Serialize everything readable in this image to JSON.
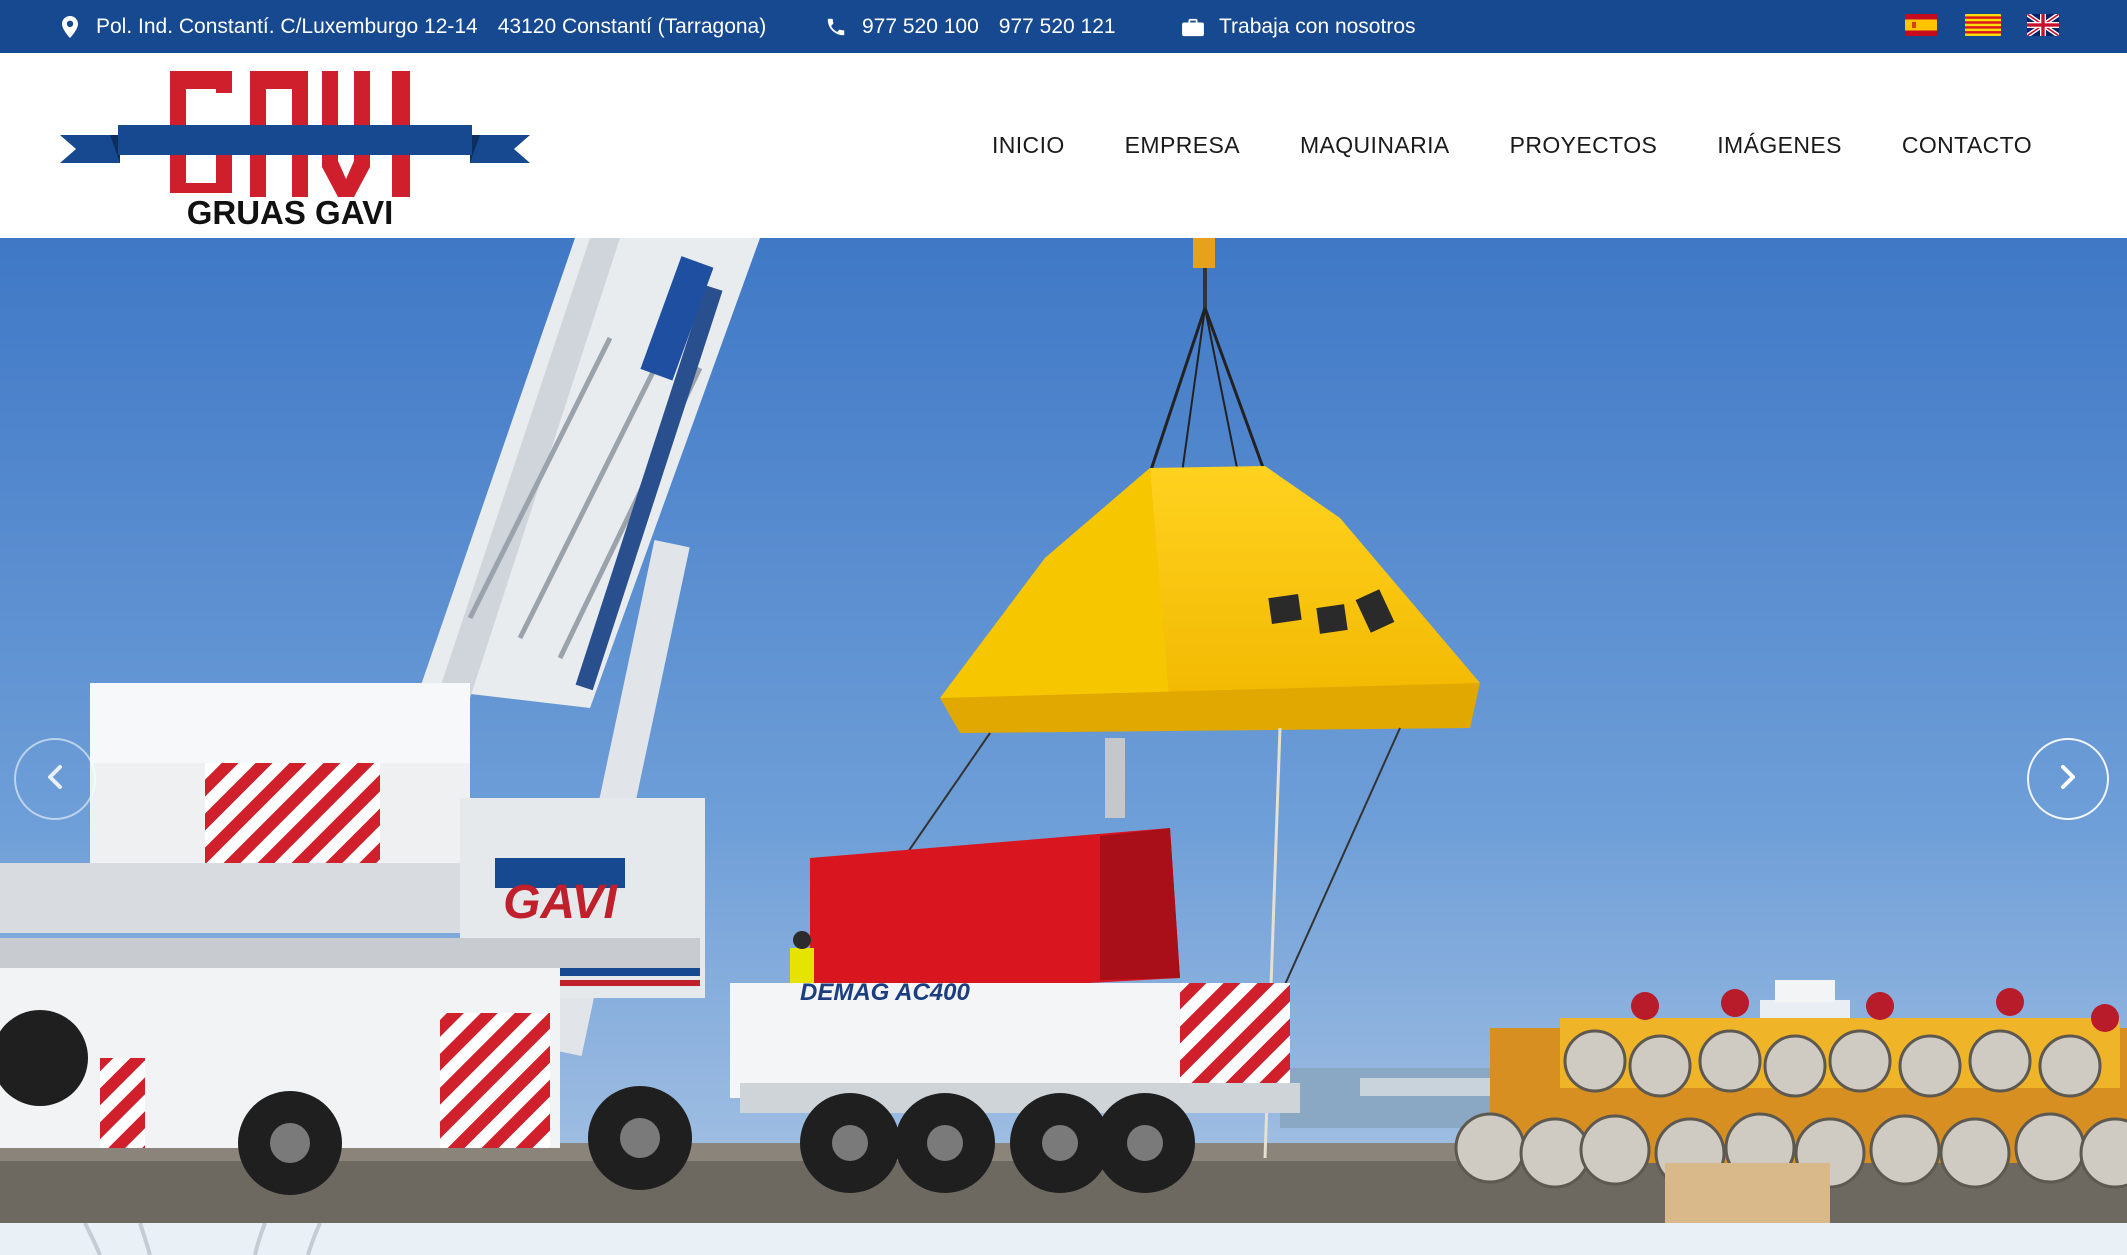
{
  "topbar": {
    "address_line1": "Pol. Ind. Constantí. C/Luxemburgo 12-14",
    "address_line2": "43120 Constantí (Tarragona)",
    "phone1": "977 520 100",
    "phone2": "977 520 121",
    "jobs_label": "Trabaja con nosotros",
    "background_color": "#16498f",
    "icons": [
      "map-marker-icon",
      "phone-icon",
      "briefcase-icon"
    ],
    "languages": [
      "es",
      "ca",
      "en"
    ]
  },
  "logo": {
    "mark_text": "GAVI",
    "wordmark": "GRUAS GAVI",
    "red": "#d01f2c",
    "blue": "#16498f"
  },
  "nav": {
    "items": [
      {
        "label": "INICIO"
      },
      {
        "label": "EMPRESA"
      },
      {
        "label": "MAQUINARIA"
      },
      {
        "label": "PROYECTOS"
      },
      {
        "label": "IMÁGENES"
      },
      {
        "label": "CONTACTO"
      }
    ]
  },
  "hero": {
    "crane_brand": "GAVI",
    "truck_model": "DEMAG AC400",
    "controls": [
      "prev-arrow-icon",
      "next-arrow-icon"
    ]
  }
}
